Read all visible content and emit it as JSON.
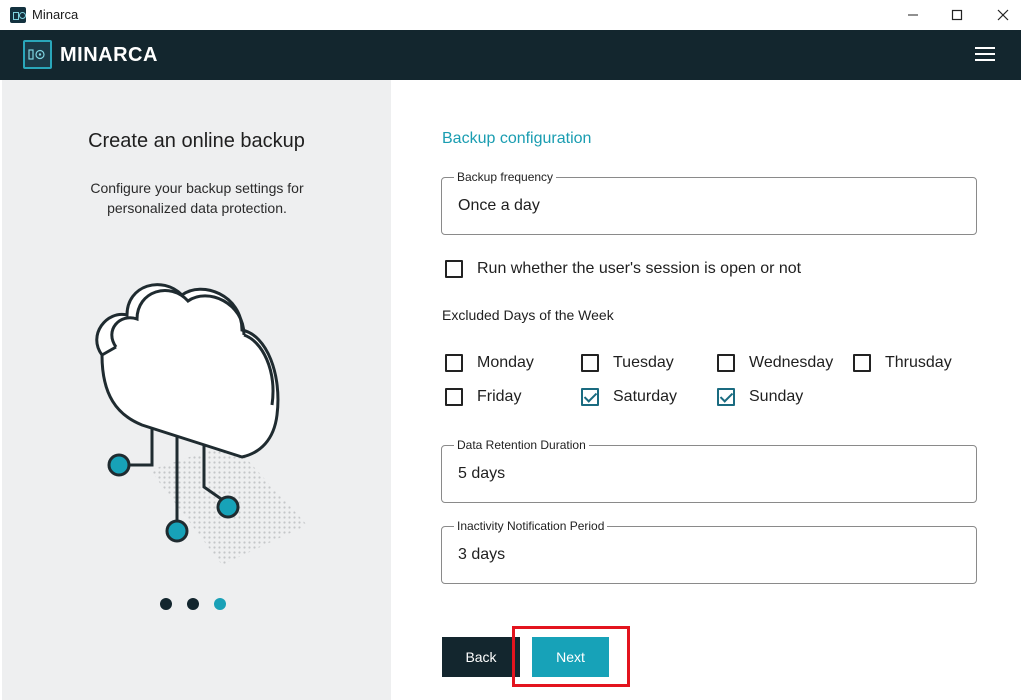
{
  "window": {
    "title": "Minarca"
  },
  "header": {
    "brand": "MINARCA"
  },
  "left": {
    "title": "Create an online backup",
    "description": "Configure your backup settings for personalized data protection.",
    "steps": 3,
    "active_step": 3
  },
  "form": {
    "section_title": "Backup configuration",
    "frequency": {
      "label": "Backup frequency",
      "value": "Once a day"
    },
    "run_session": {
      "label": "Run whether the user's session is open or not",
      "checked": false
    },
    "excluded_days": {
      "title": "Excluded Days of the Week",
      "days": [
        {
          "label": "Monday",
          "checked": false
        },
        {
          "label": "Tuesday",
          "checked": false
        },
        {
          "label": "Wednesday",
          "checked": false
        },
        {
          "label": "Thrusday",
          "checked": false
        },
        {
          "label": "Friday",
          "checked": false
        },
        {
          "label": "Saturday",
          "checked": true
        },
        {
          "label": "Sunday",
          "checked": true
        }
      ]
    },
    "retention": {
      "label": "Data Retention Duration",
      "value": "5 days"
    },
    "inactivity": {
      "label": "Inactivity Notification Period",
      "value": "3 days"
    }
  },
  "buttons": {
    "back": "Back",
    "next": "Next"
  },
  "colors": {
    "header": "#13262e",
    "accent": "#17a2b8",
    "highlight": "#e3141e",
    "left_panel": "#eeeff0"
  }
}
